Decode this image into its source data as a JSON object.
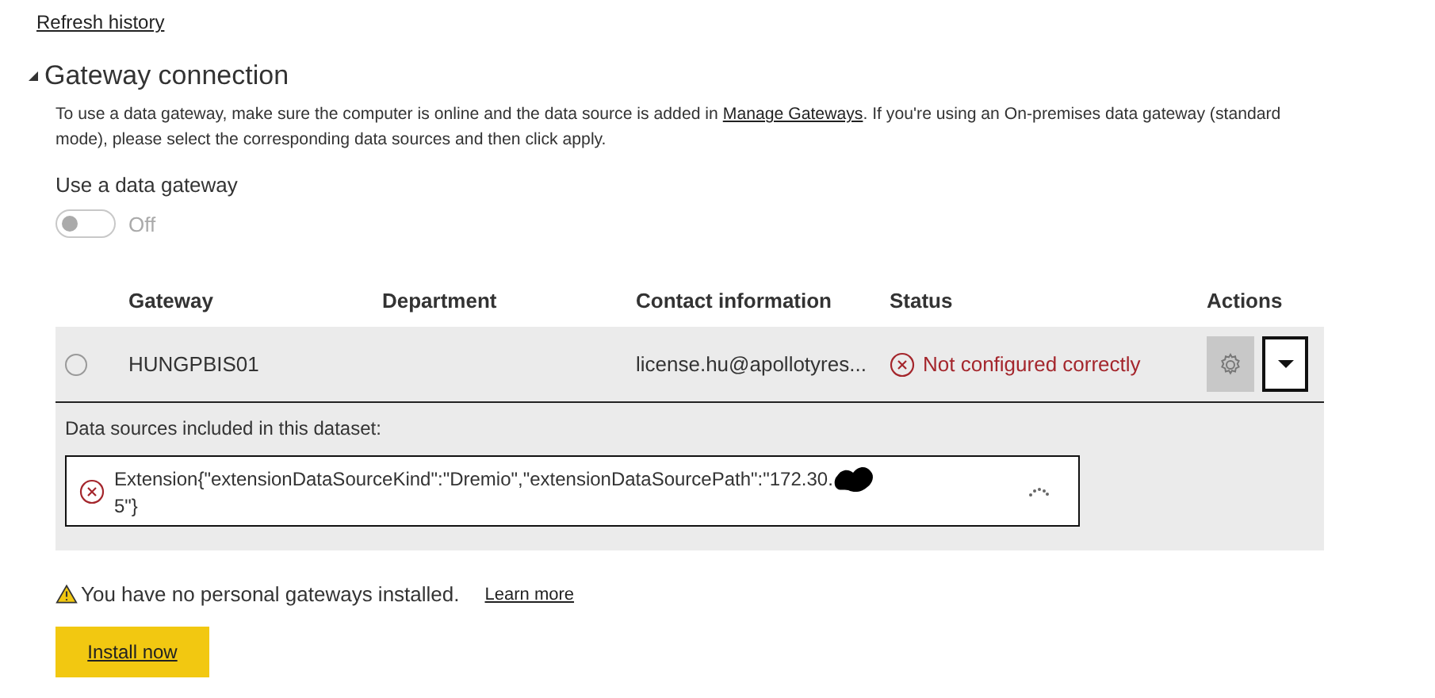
{
  "refresh_link": "Refresh history",
  "section": {
    "title": "Gateway connection",
    "expanded": true,
    "description": {
      "before": "To use a data gateway, make sure the computer is online and the data source is added in ",
      "link": "Manage Gateways",
      "after": ". If you're using an On-premises data gateway (standard mode), please select the corresponding data sources and then click apply."
    },
    "toggle": {
      "label": "Use a data gateway",
      "on": false,
      "state_text": "Off",
      "disabled": true
    },
    "table": {
      "columns": [
        "Gateway",
        "Department",
        "Contact information",
        "Status",
        "Actions"
      ],
      "rows": [
        {
          "selected": false,
          "expanded": true,
          "gateway": "HUNGPBIS01",
          "department": "",
          "contact": "license.hu@apollotyres...",
          "status": {
            "kind": "error",
            "text": "Not configured correctly"
          },
          "details": {
            "heading": "Data sources included in this dataset:",
            "sources": [
              {
                "kind": "error",
                "text": "Extension{\"extensionDataSourceKind\":\"Dremio\",\"extensionDataSourcePath\":\"172.30.",
                "text_end": "5\"}",
                "redacted": true,
                "loading": true
              }
            ]
          }
        }
      ]
    },
    "warning": {
      "text": "You have no personal gateways installed.",
      "link": "Learn more"
    },
    "install_button": "Install now"
  }
}
